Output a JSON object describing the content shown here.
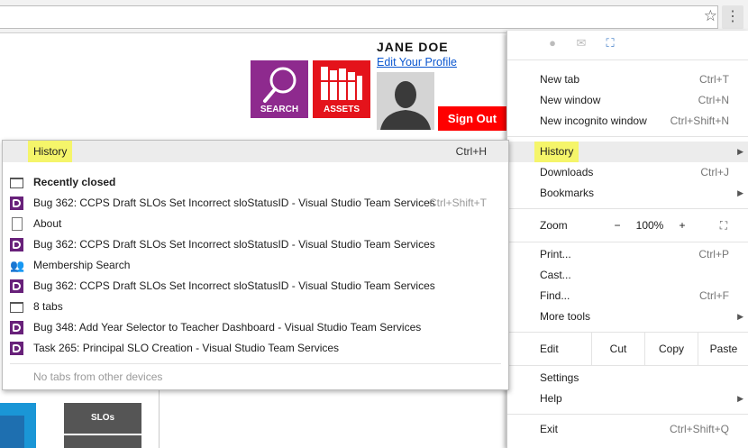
{
  "browser": {
    "star_icon": "star-icon",
    "menu_icon": "vertical-dots-icon"
  },
  "page": {
    "user_name": "JANE DOE",
    "edit_profile": "Edit Your Profile",
    "search_tile_label": "SEARCH",
    "assets_tile_label": "ASSETS",
    "sign_out": "Sign Out",
    "slos_tile_label": "SLOs",
    "colors": {
      "search_tile": "#8e2a8e",
      "assets_tile": "#e4131b",
      "sign_out": "#ff0000"
    }
  },
  "chrome_menu": {
    "new_tab": {
      "label": "New tab",
      "shortcut": "Ctrl+T"
    },
    "new_window": {
      "label": "New window",
      "shortcut": "Ctrl+N"
    },
    "new_incognito": {
      "label": "New incognito window",
      "shortcut": "Ctrl+Shift+N"
    },
    "history": {
      "label": "History"
    },
    "downloads": {
      "label": "Downloads",
      "shortcut": "Ctrl+J"
    },
    "bookmarks": {
      "label": "Bookmarks"
    },
    "zoom": {
      "label": "Zoom",
      "minus": "−",
      "value": "100%",
      "plus": "+"
    },
    "print": {
      "label": "Print...",
      "shortcut": "Ctrl+P"
    },
    "cast": {
      "label": "Cast..."
    },
    "find": {
      "label": "Find...",
      "shortcut": "Ctrl+F"
    },
    "more_tools": {
      "label": "More tools"
    },
    "edit": {
      "label": "Edit",
      "cut": "Cut",
      "copy": "Copy",
      "paste": "Paste"
    },
    "settings": {
      "label": "Settings"
    },
    "help": {
      "label": "Help"
    },
    "exit": {
      "label": "Exit",
      "shortcut": "Ctrl+Shift+Q"
    }
  },
  "history_submenu": {
    "header": {
      "label": "History",
      "shortcut": "Ctrl+H"
    },
    "recently_closed": "Recently closed",
    "items": [
      {
        "label": "Bug 362: CCPS Draft SLOs Set Incorrect sloStatusID - Visual Studio Team Services",
        "shortcut": "Ctrl+Shift+T",
        "icon": "visual-studio-icon"
      },
      {
        "label": "About",
        "shortcut": "",
        "icon": "page-icon"
      },
      {
        "label": "Bug 362: CCPS Draft SLOs Set Incorrect sloStatusID - Visual Studio Team Services",
        "shortcut": "",
        "icon": "visual-studio-icon"
      },
      {
        "label": "Membership Search",
        "shortcut": "",
        "icon": "people-icon"
      },
      {
        "label": "Bug 362: CCPS Draft SLOs Set Incorrect sloStatusID - Visual Studio Team Services",
        "shortcut": "",
        "icon": "visual-studio-icon"
      },
      {
        "label": "8 tabs",
        "shortcut": "",
        "icon": "window-icon"
      },
      {
        "label": "Bug 348: Add Year Selector to Teacher Dashboard - Visual Studio Team Services",
        "shortcut": "",
        "icon": "visual-studio-icon"
      },
      {
        "label": "Task 265: Principal SLO Creation - Visual Studio Team Services",
        "shortcut": "",
        "icon": "visual-studio-icon"
      }
    ],
    "no_tabs": "No tabs from other devices"
  }
}
